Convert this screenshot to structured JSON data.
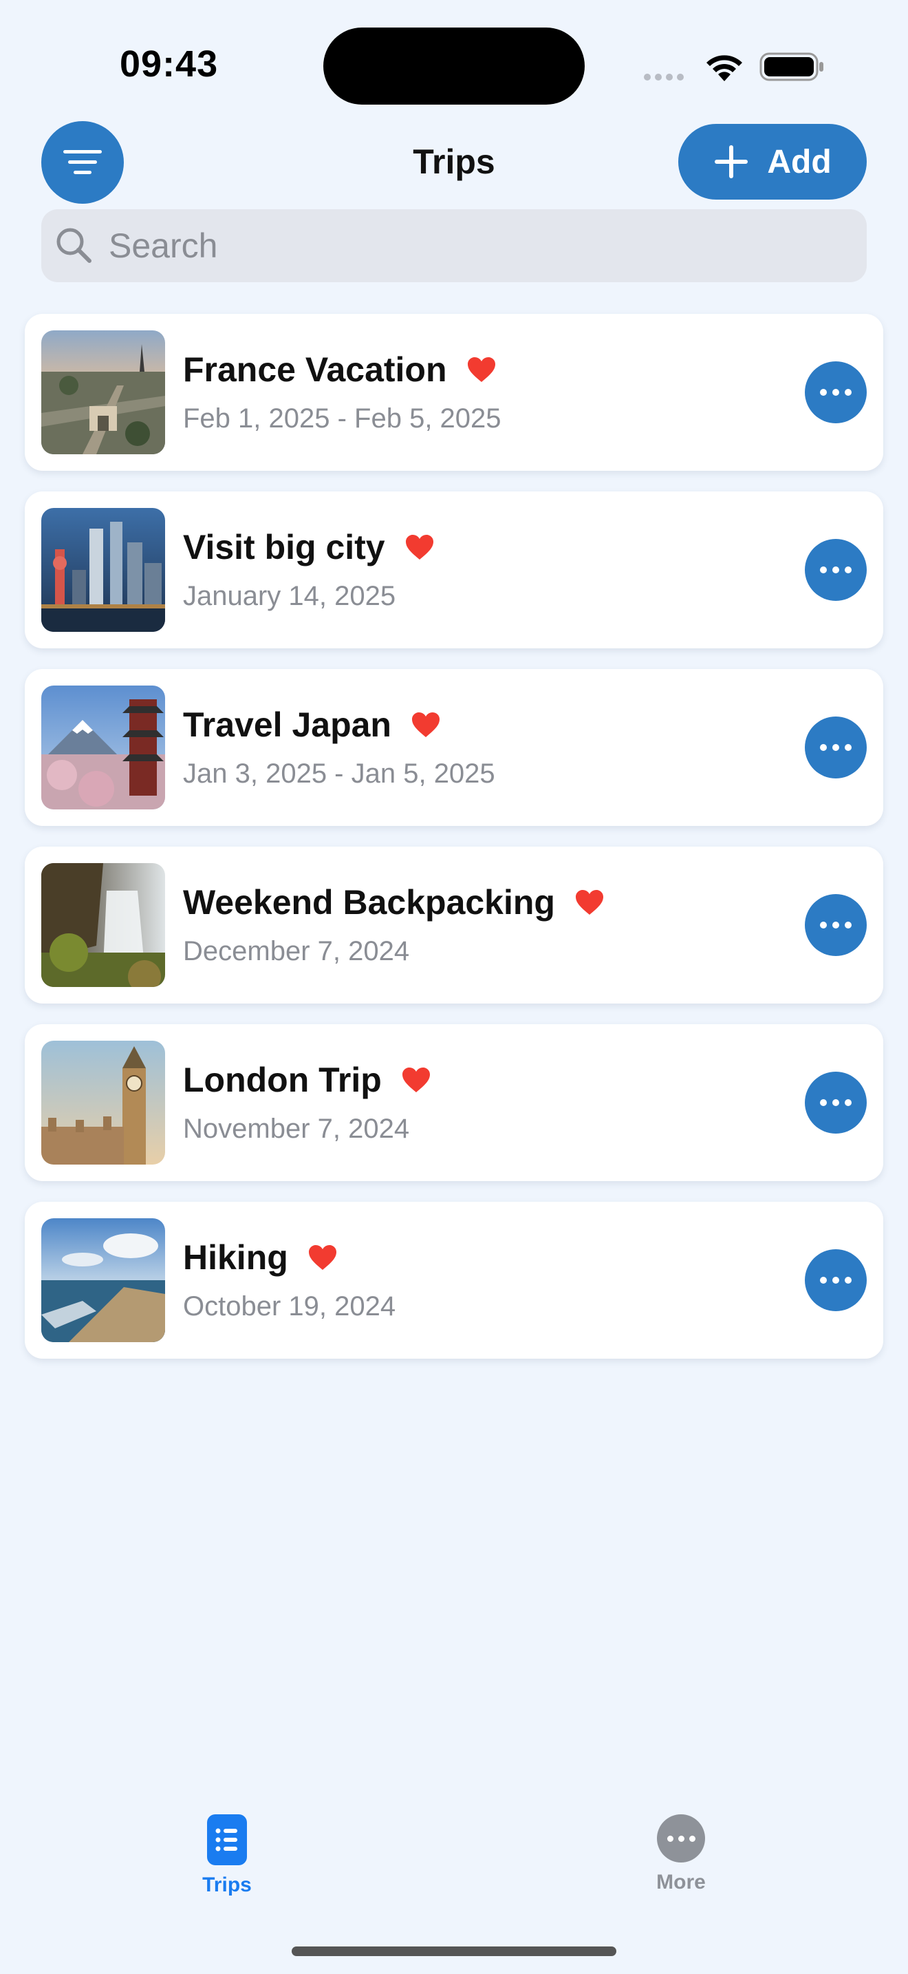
{
  "status_bar": {
    "time": "09:43"
  },
  "header": {
    "title": "Trips",
    "add_label": "Add"
  },
  "search": {
    "placeholder": "Search",
    "value": ""
  },
  "trips": [
    {
      "name": "France Vacation",
      "date": "Feb 1, 2025 - Feb 5, 2025",
      "favorite": true
    },
    {
      "name": "Visit big city",
      "date": "January 14, 2025",
      "favorite": true
    },
    {
      "name": "Travel Japan",
      "date": "Jan 3, 2025 - Jan 5, 2025",
      "favorite": true
    },
    {
      "name": "Weekend Backpacking",
      "date": "December 7, 2024",
      "favorite": true
    },
    {
      "name": "London Trip",
      "date": "November 7, 2024",
      "favorite": true
    },
    {
      "name": "Hiking",
      "date": "October 19, 2024",
      "favorite": true
    }
  ],
  "tab_bar": {
    "items": [
      {
        "label": "Trips",
        "icon": "list-icon",
        "active": true
      },
      {
        "label": "More",
        "icon": "ellipsis-icon",
        "active": false
      }
    ]
  },
  "colors": {
    "accent": "#2c7bc4",
    "tab_active": "#1a7cf0",
    "favorite": "#f23b30",
    "background": "#eff5fd"
  }
}
